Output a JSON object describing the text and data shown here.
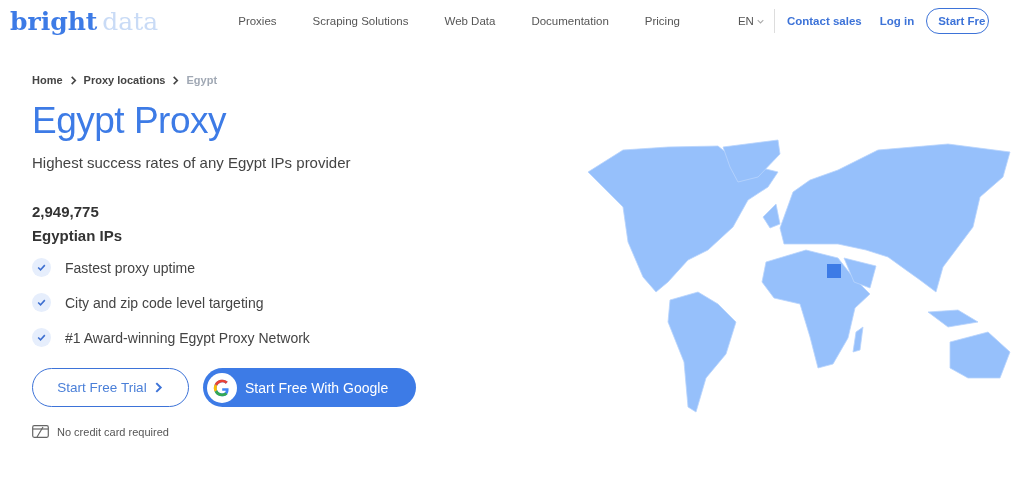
{
  "logo": {
    "bold": "bright",
    "light": "data"
  },
  "nav": [
    "Proxies",
    "Scraping Solutions",
    "Web Data",
    "Documentation",
    "Pricing"
  ],
  "language": "EN",
  "actions": {
    "contact": "Contact sales",
    "login": "Log in",
    "start": "Start Fre"
  },
  "breadcrumb": [
    {
      "label": "Home",
      "current": false
    },
    {
      "label": "Proxy locations",
      "current": false
    },
    {
      "label": "Egypt",
      "current": true
    }
  ],
  "title": "Egypt Proxy",
  "subtitle": "Highest success rates of any Egypt IPs provider",
  "stat": {
    "value": "2,949,775",
    "label": "Egyptian IPs"
  },
  "features": [
    "Fastest proxy uptime",
    "City and zip code level targeting",
    "#1 Award-winning Egypt Proxy Network"
  ],
  "buttons": {
    "trial": "Start Free Trial",
    "google": "Start Free With Google"
  },
  "note": "No credit card required"
}
